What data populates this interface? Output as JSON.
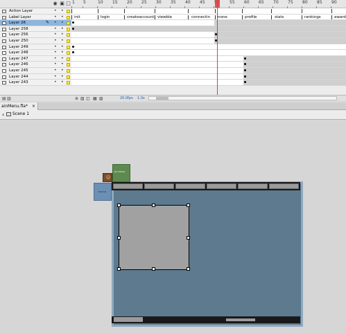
{
  "timeline": {
    "ruler_ticks": [
      "1",
      "5",
      "10",
      "15",
      "20",
      "25",
      "30",
      "35",
      "40",
      "45",
      "50",
      "55",
      "60",
      "65",
      "70",
      "75",
      "80",
      "85",
      "90"
    ],
    "layers": [
      {
        "name": "Action Layer"
      },
      {
        "name": "Label Layer"
      },
      {
        "name": "Layer 26"
      },
      {
        "name": "Layer 258"
      },
      {
        "name": "Layer 256"
      },
      {
        "name": "Layer 250"
      },
      {
        "name": "Layer 249"
      },
      {
        "name": "Layer 248"
      },
      {
        "name": "Layer 247"
      },
      {
        "name": "Layer 246"
      },
      {
        "name": "Layer 245"
      },
      {
        "name": "Layer 244"
      },
      {
        "name": "Layer 243"
      }
    ],
    "frame_labels": [
      "init",
      "login",
      "createaccount",
      "viewble",
      "connectin",
      "none",
      "profile",
      "stats",
      "rankings",
      "awards"
    ],
    "vis_glyph": "•",
    "lock_glyph": "•",
    "footer": {
      "fps": "20.0fps",
      "sec": "1.0s"
    }
  },
  "tab": {
    "label": "ainMenu.fla*",
    "close": "×"
  },
  "scene": {
    "label": "Scene 1"
  },
  "stage": {
    "sidebox_text": "Tutorial",
    "greenbox_text": "NO IMAGE",
    "avatar_glyph": "☺"
  },
  "colors": {
    "playhead": "#e03a3a",
    "selected_layer": "#8db5de",
    "stage_bg": "#5d7a8f",
    "navbar": "#191919"
  },
  "icons": {
    "eye": "eye-icon",
    "lock": "lock-icon",
    "outline": "outline-icon",
    "layer": "layer-icon",
    "scene": "scene-icon",
    "back": "back-arrow-icon"
  }
}
